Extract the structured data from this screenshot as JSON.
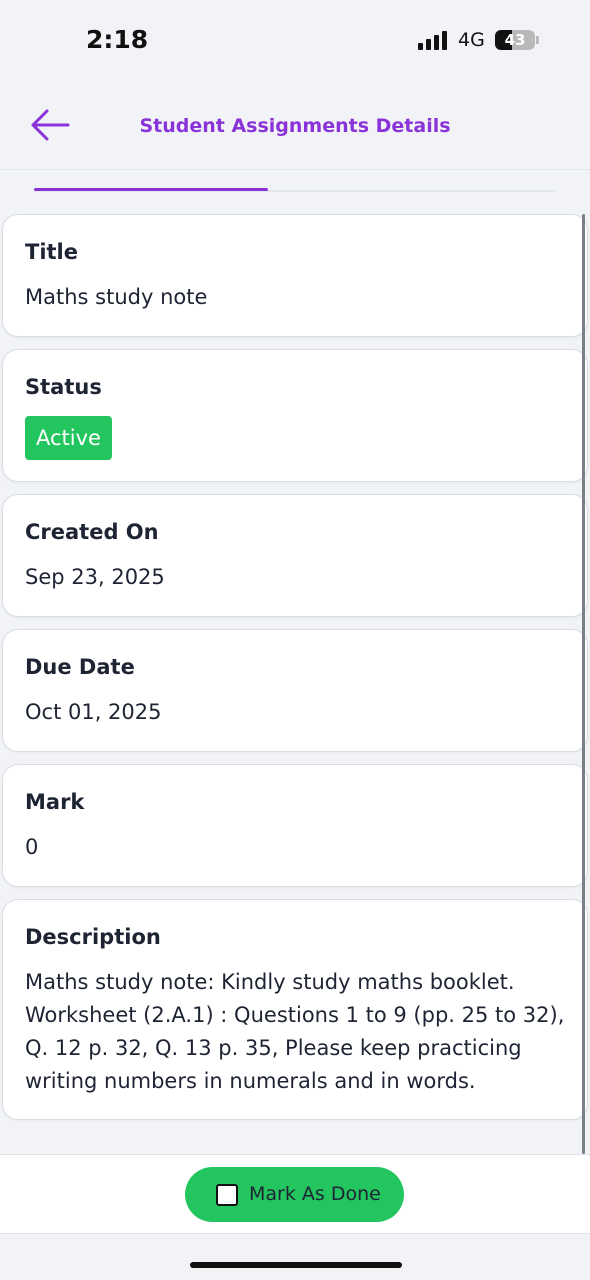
{
  "status_bar": {
    "time": "2:18",
    "network": "4G",
    "battery": "43",
    "battery_level": 0.43
  },
  "header": {
    "title": "Student Assignments Details",
    "accent_color": "#8a33d8"
  },
  "fields": {
    "title": {
      "label": "Title",
      "value": "Maths study note"
    },
    "status": {
      "label": "Status",
      "value": "Active",
      "color": "#22c55e"
    },
    "created_on": {
      "label": "Created On",
      "value": "Sep 23, 2025"
    },
    "due_date": {
      "label": "Due Date",
      "value": "Oct 01, 2025"
    },
    "mark": {
      "label": "Mark",
      "value": "0"
    },
    "description": {
      "label": "Description",
      "value": "Maths study note: Kindly study maths booklet. Worksheet (2.A.1) : Questions 1 to 9 (pp. 25 to 32), Q. 12 p. 32, Q. 13 p. 35, Please keep practicing writing numbers in numerals and in words."
    }
  },
  "actions": {
    "mark_done_label": "Mark As Done",
    "mark_done_checked": false
  },
  "icons": {
    "back": "arrow-left-icon",
    "signal": "signal-icon",
    "battery": "battery-icon",
    "checkbox": "checkbox-icon"
  }
}
